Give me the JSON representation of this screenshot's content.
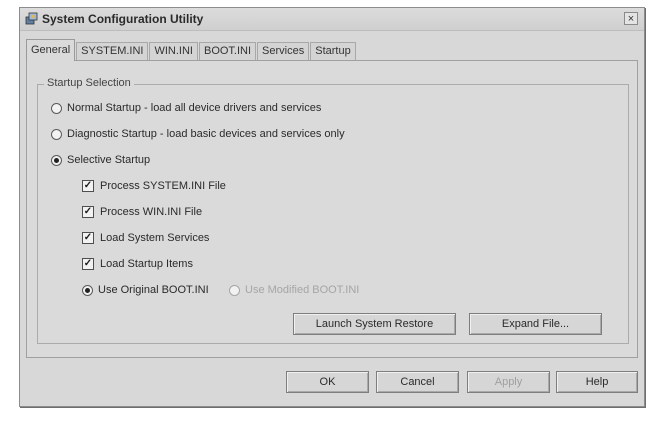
{
  "window": {
    "title": "System Configuration Utility",
    "close_label": "×"
  },
  "tabs": [
    {
      "label": "General"
    },
    {
      "label": "SYSTEM.INI"
    },
    {
      "label": "WIN.INI"
    },
    {
      "label": "BOOT.INI"
    },
    {
      "label": "Services"
    },
    {
      "label": "Startup"
    }
  ],
  "active_tab": "General",
  "startup_selection": {
    "group_label": "Startup Selection",
    "normal": {
      "label": "Normal Startup - load all device drivers and services",
      "selected": false
    },
    "diagnostic": {
      "label": "Diagnostic Startup - load basic devices and services only",
      "selected": false
    },
    "selective": {
      "label": "Selective Startup",
      "selected": true
    },
    "options": [
      {
        "label": "Process SYSTEM.INI File",
        "checked": true
      },
      {
        "label": "Process WIN.INI File",
        "checked": true
      },
      {
        "label": "Load System Services",
        "checked": true
      },
      {
        "label": "Load Startup Items",
        "checked": true
      }
    ],
    "boot_original": {
      "label": "Use Original BOOT.INI",
      "selected": true
    },
    "boot_modified": {
      "label": "Use Modified BOOT.INI",
      "selected": false,
      "enabled": false
    }
  },
  "actions": {
    "launch_restore": "Launch System Restore",
    "expand_file": "Expand File..."
  },
  "footer": {
    "ok": "OK",
    "cancel": "Cancel",
    "apply": "Apply",
    "help": "Help"
  },
  "check_mark": "✓"
}
